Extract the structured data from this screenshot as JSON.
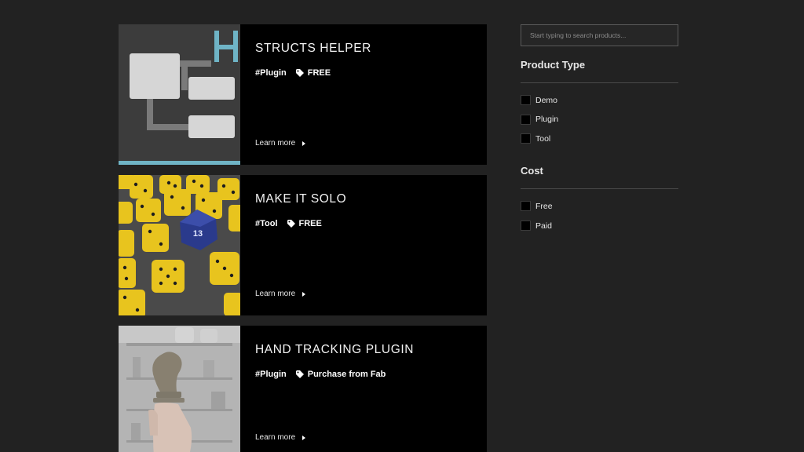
{
  "products": [
    {
      "title": "STRUCTS HELPER",
      "category": "#Plugin",
      "price": "FREE",
      "link": "Learn more",
      "thumb_icon": "struct-diagram-image"
    },
    {
      "title": "MAKE IT SOLO",
      "category": "#Tool",
      "price": "FREE",
      "link": "Learn more",
      "thumb_icon": "dice-image"
    },
    {
      "title": "HAND TRACKING PLUGIN",
      "category": "#Plugin",
      "price": "Purchase from Fab",
      "link": "Learn more",
      "thumb_icon": "hand-chess-knight-image"
    }
  ],
  "sidebar": {
    "search_placeholder": "Start typing to search products...",
    "product_type": {
      "title": "Product Type",
      "options": [
        "Demo",
        "Plugin",
        "Tool"
      ]
    },
    "cost": {
      "title": "Cost",
      "options": [
        "Free",
        "Paid"
      ]
    }
  },
  "colors": {
    "background": "#222222",
    "card": "#000000",
    "accent_blue": "#6fb4c6"
  }
}
